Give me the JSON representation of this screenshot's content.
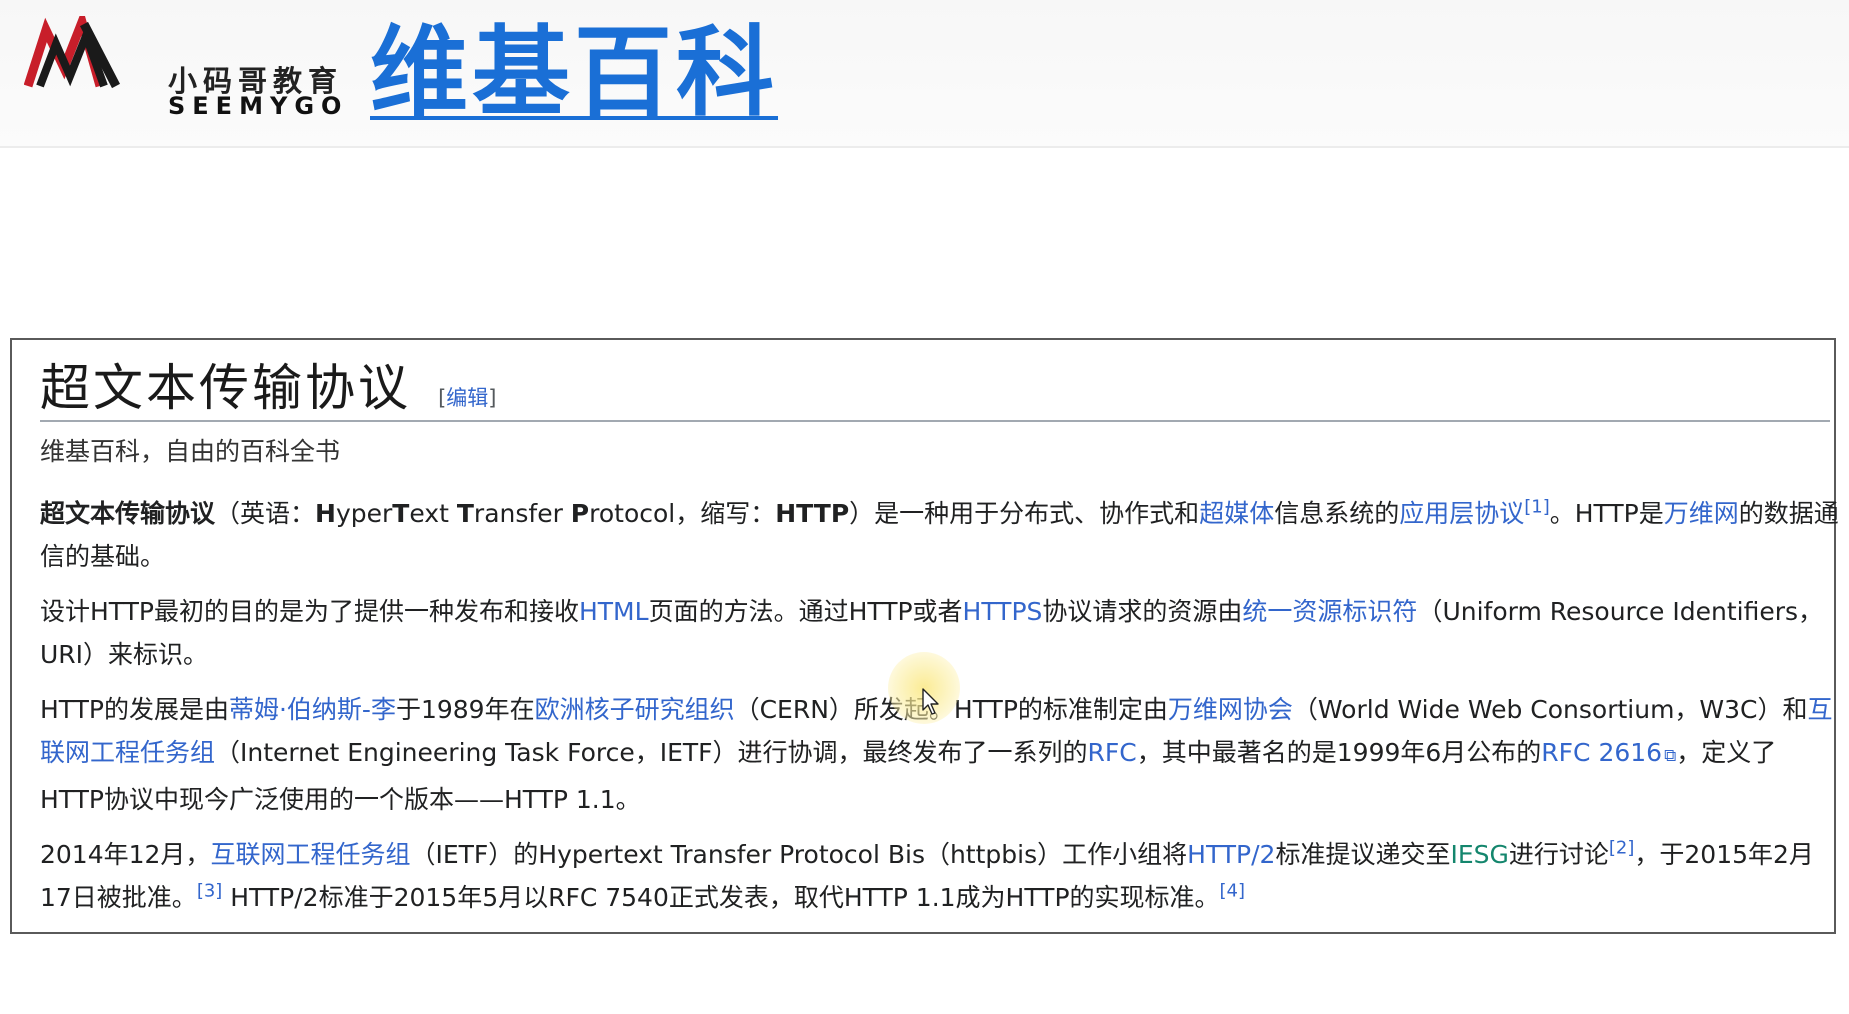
{
  "header": {
    "logo_cn": "小码哥教育",
    "logo_en": "SEEMYGO",
    "site_title": "维基百科",
    "title_color": "#1a6fd6"
  },
  "article": {
    "title": "超文本传输协议",
    "edit_link": "编辑",
    "edit_bracket_open": "[",
    "edit_bracket_close": "]",
    "tagline": "维基百科，自由的百科全书",
    "p1": {
      "s1": "超文本传输协议",
      "s2": "（英语：",
      "s3": "H",
      "s4": "yper",
      "s5": "T",
      "s6": "ext ",
      "s7": "T",
      "s8": "ransfer ",
      "s9": "P",
      "s10": "rotocol，缩写：",
      "s11": "HTTP",
      "s12": "）是一种用于分布式、协作式和",
      "l1": "超媒体",
      "s13": "信息系统的",
      "l2": "应用层协议",
      "r1": "[1]",
      "s14": "。HTTP是",
      "l3": "万维网",
      "s15": "的数据通信的基础。"
    },
    "p2": {
      "s1": "设计HTTP最初的目的是为了提供一种发布和接收",
      "l1": "HTML",
      "s2": "页面的方法。通过HTTP或者",
      "l2": "HTTPS",
      "s3": "协议请求的资源由",
      "l3": "统一资源标识符",
      "s4": "（Uniform Resource Identifiers，URI）来标识。"
    },
    "p3": {
      "s1": "HTTP的发展是由",
      "l1": "蒂姆·伯纳斯-李",
      "s2": "于1989年在",
      "l2": "欧洲核子研究组织",
      "s3": "（CERN）所发起。HTTP的标准制定由",
      "l3": "万维网协会",
      "s4": "（World Wide Web Consortium，W3C）和",
      "l4": "互联网工程任务组",
      "s5": "（Internet Engineering Task Force，IETF）进行协调，最终发布了一系列的",
      "l5": "RFC",
      "s6": "，其中最著名的是1999年6月公布的",
      "l6": "RFC 2616",
      "s7": "，定义了HTTP协议中现今广泛使用的一个版本——HTTP 1.1。"
    },
    "p4": {
      "s1": "2014年12月，",
      "l1": "互联网工程任务组",
      "s2": "（IETF）的Hypertext Transfer Protocol Bis（httpbis）工作小组将",
      "l2": "HTTP/2",
      "s3": "标准提议递交至",
      "l3": "IESG",
      "s4": "进行讨论",
      "r1": "[2]",
      "s5": "，于2015年2月17日被批准。",
      "r2": "[3]",
      "s6": " HTTP/2标准于2015年5月以RFC 7540正式发表，取代HTTP 1.1成为HTTP的实现标准。",
      "r3": "[4]"
    }
  },
  "colors": {
    "link": "#3366cc",
    "link_green": "#14866d",
    "text": "#202122"
  },
  "icons": {
    "external_link": "external-link-icon",
    "mouse_cursor": "mouse-cursor-icon"
  }
}
